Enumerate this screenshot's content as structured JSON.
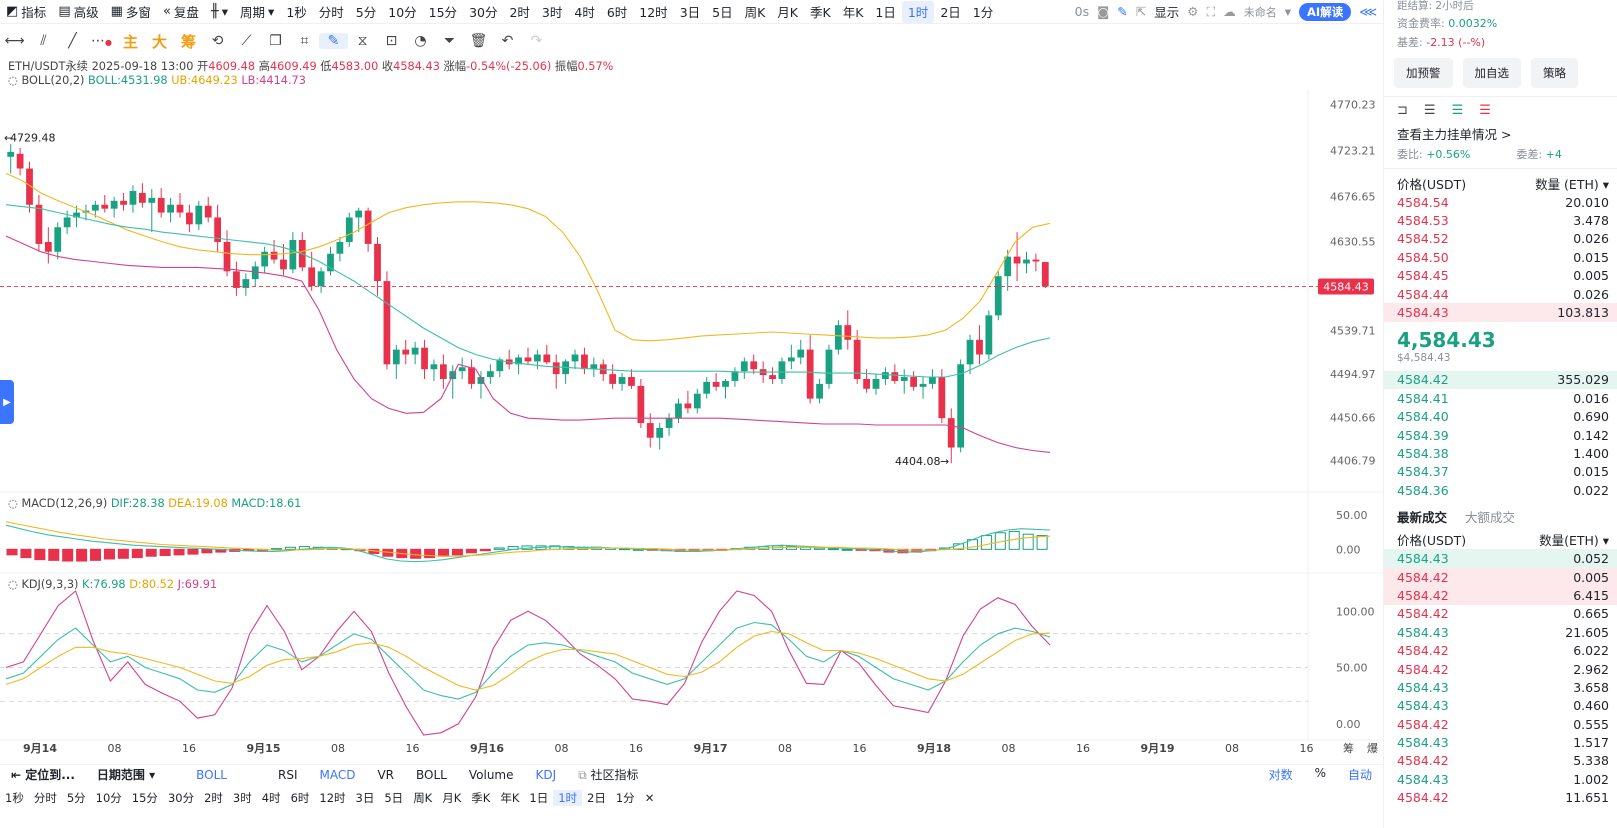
{
  "toolbar": {
    "items": [
      "指标",
      "高级",
      "多窗",
      "复盘",
      "",
      "周期",
      "1秒",
      "分时",
      "5分",
      "10分",
      "15分",
      "30分",
      "2时",
      "3时",
      "4时",
      "6时",
      "12时",
      "3日",
      "5日",
      "周K",
      "月K",
      "季K",
      "年K",
      "1日",
      "1时",
      "2日",
      "1分"
    ],
    "active": "1时",
    "right": {
      "seconds": "0s",
      "display": "显示",
      "unnamed": "未命名",
      "ai": "AI解读"
    }
  },
  "drawbar": {
    "levels": [
      "主",
      "大",
      "筹"
    ]
  },
  "legend": {
    "pair": "ETH/USDT永续",
    "time": "2025-09-18 13:00",
    "open_label": "开",
    "open": "4609.48",
    "high_label": "高",
    "high": "4609.49",
    "low_label": "低",
    "low": "4583.00",
    "close_label": "收",
    "close": "4584.43",
    "change_label": "涨幅",
    "change": "-0.54%(-25.06)",
    "amp_label": "振幅",
    "amp": "0.57%",
    "boll": "BOLL(20,2)",
    "boll_mid": "BOLL:4531.98",
    "boll_ub": "UB:4649.23",
    "boll_lb": "LB:4414.73",
    "macd": "MACD(12,26,9)",
    "dif": "DIF:28.38",
    "dea": "DEA:19.08",
    "macd_v": "MACD:18.61",
    "kdj": "KDJ(9,3,3)",
    "k": "K:76.98",
    "d": "D:80.52",
    "j": "J:69.91"
  },
  "chart_data": {
    "type": "candlestick",
    "price_axis": [
      "4770.23",
      "4723.21",
      "4676.65",
      "4630.55",
      "4584.43",
      "4539.71",
      "4494.97",
      "4450.66",
      "4406.79"
    ],
    "current_price": "4584.43",
    "max_label": "4729.48",
    "min_label": "4404.08",
    "macd_axis": [
      "50.00",
      "0.00"
    ],
    "kdj_axis": [
      "100.00",
      "50.00",
      "0.00"
    ],
    "time_axis": [
      "9月14",
      "08",
      "16",
      "9月15",
      "08",
      "16",
      "9月16",
      "08",
      "16",
      "9月17",
      "08",
      "16",
      "9月18",
      "08",
      "16",
      "9月19",
      "08",
      "16"
    ],
    "axis_corner": [
      "筹",
      "爆"
    ],
    "candles": [
      [
        4717,
        4730,
        4700,
        4722
      ],
      [
        4720,
        4726,
        4698,
        4705
      ],
      [
        4705,
        4712,
        4660,
        4668
      ],
      [
        4668,
        4678,
        4620,
        4628
      ],
      [
        4630,
        4645,
        4608,
        4620
      ],
      [
        4620,
        4650,
        4612,
        4645
      ],
      [
        4645,
        4662,
        4638,
        4655
      ],
      [
        4655,
        4667,
        4645,
        4660
      ],
      [
        4660,
        4668,
        4652,
        4662
      ],
      [
        4662,
        4672,
        4655,
        4668
      ],
      [
        4668,
        4678,
        4660,
        4664
      ],
      [
        4664,
        4676,
        4655,
        4672
      ],
      [
        4672,
        4680,
        4662,
        4668
      ],
      [
        4668,
        4688,
        4660,
        4682
      ],
      [
        4680,
        4690,
        4665,
        4670
      ],
      [
        4670,
        4684,
        4640,
        4675
      ],
      [
        4675,
        4685,
        4655,
        4660
      ],
      [
        4660,
        4675,
        4650,
        4668
      ],
      [
        4668,
        4680,
        4655,
        4660
      ],
      [
        4660,
        4668,
        4640,
        4648
      ],
      [
        4648,
        4672,
        4642,
        4667
      ],
      [
        4667,
        4676,
        4650,
        4655
      ],
      [
        4655,
        4668,
        4620,
        4630
      ],
      [
        4630,
        4642,
        4595,
        4600
      ],
      [
        4600,
        4610,
        4575,
        4583
      ],
      [
        4583,
        4598,
        4575,
        4592
      ],
      [
        4592,
        4610,
        4585,
        4605
      ],
      [
        4605,
        4625,
        4598,
        4620
      ],
      [
        4620,
        4632,
        4608,
        4612
      ],
      [
        4612,
        4628,
        4596,
        4602
      ],
      [
        4602,
        4640,
        4598,
        4632
      ],
      [
        4632,
        4640,
        4600,
        4604
      ],
      [
        4604,
        4620,
        4580,
        4585
      ],
      [
        4585,
        4604,
        4578,
        4600
      ],
      [
        4600,
        4625,
        4596,
        4618
      ],
      [
        4618,
        4635,
        4610,
        4630
      ],
      [
        4630,
        4660,
        4625,
        4655
      ],
      [
        4655,
        4665,
        4640,
        4662
      ],
      [
        4662,
        4665,
        4620,
        4628
      ],
      [
        4628,
        4635,
        4575,
        4590
      ],
      [
        4590,
        4600,
        4500,
        4505
      ],
      [
        4505,
        4525,
        4490,
        4520
      ],
      [
        4520,
        4530,
        4505,
        4515
      ],
      [
        4515,
        4528,
        4505,
        4522
      ],
      [
        4522,
        4530,
        4490,
        4500
      ],
      [
        4500,
        4510,
        4488,
        4505
      ],
      [
        4505,
        4515,
        4480,
        4490
      ],
      [
        4490,
        4504,
        4470,
        4498
      ],
      [
        4498,
        4512,
        4490,
        4502
      ],
      [
        4502,
        4510,
        4480,
        4485
      ],
      [
        4485,
        4498,
        4470,
        4492
      ],
      [
        4492,
        4505,
        4485,
        4498
      ],
      [
        4498,
        4512,
        4492,
        4510
      ],
      [
        4510,
        4520,
        4500,
        4505
      ],
      [
        4505,
        4515,
        4495,
        4512
      ],
      [
        4512,
        4522,
        4505,
        4508
      ],
      [
        4508,
        4520,
        4500,
        4515
      ],
      [
        4515,
        4525,
        4505,
        4507
      ],
      [
        4507,
        4515,
        4480,
        4495
      ],
      [
        4495,
        4510,
        4485,
        4508
      ],
      [
        4508,
        4520,
        4500,
        4515
      ],
      [
        4515,
        4522,
        4495,
        4500
      ],
      [
        4500,
        4512,
        4492,
        4505
      ],
      [
        4505,
        4510,
        4488,
        4495
      ],
      [
        4495,
        4505,
        4480,
        4485
      ],
      [
        4485,
        4496,
        4478,
        4492
      ],
      [
        4492,
        4500,
        4480,
        4483
      ],
      [
        4483,
        4490,
        4440,
        4445
      ],
      [
        4445,
        4455,
        4420,
        4430
      ],
      [
        4430,
        4445,
        4418,
        4440
      ],
      [
        4440,
        4455,
        4432,
        4450
      ],
      [
        4450,
        4470,
        4445,
        4465
      ],
      [
        4465,
        4478,
        4455,
        4460
      ],
      [
        4460,
        4480,
        4455,
        4475
      ],
      [
        4475,
        4492,
        4470,
        4487
      ],
      [
        4487,
        4496,
        4478,
        4482
      ],
      [
        4482,
        4490,
        4470,
        4488
      ],
      [
        4488,
        4502,
        4482,
        4498
      ],
      [
        4498,
        4512,
        4490,
        4508
      ],
      [
        4508,
        4515,
        4495,
        4500
      ],
      [
        4500,
        4508,
        4486,
        4494
      ],
      [
        4494,
        4502,
        4485,
        4490
      ],
      [
        4490,
        4512,
        4485,
        4508
      ],
      [
        4508,
        4525,
        4500,
        4512
      ],
      [
        4512,
        4530,
        4505,
        4520
      ],
      [
        4520,
        4535,
        4465,
        4470
      ],
      [
        4470,
        4490,
        4465,
        4485
      ],
      [
        4485,
        4525,
        4480,
        4520
      ],
      [
        4520,
        4550,
        4515,
        4545
      ],
      [
        4545,
        4560,
        4520,
        4530
      ],
      [
        4530,
        4540,
        4485,
        4490
      ],
      [
        4490,
        4500,
        4476,
        4480
      ],
      [
        4480,
        4495,
        4474,
        4490
      ],
      [
        4490,
        4502,
        4484,
        4497
      ],
      [
        4497,
        4505,
        4485,
        4488
      ],
      [
        4488,
        4500,
        4475,
        4492
      ],
      [
        4492,
        4498,
        4478,
        4482
      ],
      [
        4482,
        4492,
        4470,
        4485
      ],
      [
        4485,
        4500,
        4480,
        4492
      ],
      [
        4492,
        4500,
        4445,
        4450
      ],
      [
        4450,
        4460,
        4404,
        4420
      ],
      [
        4420,
        4510,
        4415,
        4505
      ],
      [
        4505,
        4535,
        4495,
        4530
      ],
      [
        4530,
        4545,
        4505,
        4515
      ],
      [
        4515,
        4560,
        4510,
        4555
      ],
      [
        4555,
        4600,
        4550,
        4595
      ],
      [
        4595,
        4622,
        4580,
        4615
      ],
      [
        4615,
        4640,
        4590,
        4608
      ],
      [
        4608,
        4620,
        4598,
        4612
      ],
      [
        4612,
        4618,
        4600,
        4610
      ],
      [
        4609.48,
        4609.49,
        4583.0,
        4584.43
      ]
    ],
    "boll_ub_values": [
      4700,
      4692,
      4680,
      4672,
      4665,
      4658,
      4650,
      4642,
      4636,
      4630,
      4625,
      4622,
      4620,
      4618,
      4617,
      4617,
      4618,
      4620,
      4625,
      4632,
      4640,
      4650,
      4660,
      4665,
      4668,
      4670,
      4671,
      4671,
      4670,
      4668,
      4664,
      4656,
      4640,
      4615,
      4580,
      4540,
      4530,
      4529,
      4530,
      4532,
      4534,
      4535,
      4536,
      4537,
      4538,
      4537,
      4536,
      4535,
      4534,
      4533,
      4532,
      4532,
      4533,
      4535,
      4540,
      4552,
      4570,
      4600,
      4630,
      4645,
      4649
    ],
    "boll_mid_values": [
      4668,
      4666,
      4664,
      4660,
      4656,
      4652,
      4648,
      4645,
      4643,
      4640,
      4638,
      4636,
      4634,
      4632,
      4630,
      4628,
      4624,
      4618,
      4610,
      4600,
      4590,
      4578,
      4566,
      4554,
      4542,
      4532,
      4522,
      4515,
      4510,
      4507,
      4505,
      4503,
      4502,
      4501,
      4500,
      4499,
      4498,
      4498,
      4498,
      4498,
      4498,
      4498,
      4497,
      4497,
      4497,
      4497,
      4497,
      4496,
      4496,
      4496,
      4495,
      4494,
      4493,
      4492,
      4492,
      4496,
      4504,
      4514,
      4522,
      4528,
      4532
    ],
    "boll_lb_values": [
      4636,
      4628,
      4620,
      4615,
      4612,
      4610,
      4608,
      4606,
      4605,
      4604,
      4604,
      4604,
      4603,
      4602,
      4600,
      4598,
      4595,
      4590,
      4560,
      4520,
      4490,
      4470,
      4460,
      4455,
      4456,
      4470,
      4505,
      4500,
      4470,
      4455,
      4450,
      4449,
      4448,
      4448,
      4449,
      4450,
      4450,
      4450,
      4450,
      4450,
      4450,
      4450,
      4449,
      4448,
      4447,
      4446,
      4445,
      4444,
      4444,
      4444,
      4443,
      4443,
      4443,
      4443,
      4443,
      4440,
      4432,
      4425,
      4420,
      4417,
      4415
    ],
    "macd_hist": [
      -8,
      -12,
      -15,
      -16,
      -17,
      -17,
      -16,
      -14,
      -13,
      -12,
      -10,
      -9,
      -8,
      -7,
      -5,
      -4,
      -3,
      -2,
      -1,
      1,
      3,
      4,
      3,
      2,
      1,
      -2,
      -6,
      -10,
      -12,
      -13,
      -12,
      -10,
      -8,
      -5,
      -2,
      2,
      4,
      5,
      5,
      5,
      4,
      3,
      3,
      2,
      1,
      0,
      -1,
      -2,
      -3,
      -3,
      -2,
      -1,
      1,
      3,
      4,
      5,
      4,
      3,
      2,
      1,
      0,
      -1,
      -2,
      -4,
      -5,
      -4,
      -2,
      2,
      8,
      14,
      20,
      24,
      26,
      22,
      20
    ],
    "macd_dif": [
      35,
      30,
      25,
      21,
      18,
      15,
      12,
      10,
      8,
      6,
      5,
      4,
      3,
      2,
      1,
      0,
      -1,
      -2,
      -3,
      -3,
      -2,
      0,
      2,
      3,
      2,
      -2,
      -8,
      -14,
      -17,
      -18,
      -17,
      -15,
      -12,
      -9,
      -6,
      -3,
      0,
      2,
      3,
      4,
      3,
      3,
      3,
      2,
      1,
      0,
      -1,
      -2,
      -3,
      -3,
      -2,
      -1,
      1,
      3,
      5,
      6,
      5,
      4,
      3,
      2,
      1,
      0,
      -1,
      -3,
      -4,
      -3,
      -1,
      3,
      10,
      18,
      24,
      28,
      30,
      29,
      28
    ],
    "macd_dea": [
      40,
      36,
      32,
      28,
      24,
      21,
      18,
      15,
      13,
      11,
      9,
      7,
      6,
      5,
      4,
      3,
      2,
      1,
      0,
      -1,
      -1,
      -1,
      0,
      1,
      1,
      0,
      -2,
      -4,
      -6,
      -8,
      -9,
      -10,
      -10,
      -9,
      -8,
      -6,
      -4,
      -3,
      -1,
      0,
      1,
      1,
      2,
      2,
      2,
      1,
      1,
      0,
      -1,
      -1,
      -1,
      -1,
      0,
      1,
      2,
      3,
      3,
      3,
      3,
      3,
      2,
      2,
      1,
      0,
      -1,
      -1,
      -1,
      0,
      2,
      5,
      9,
      13,
      16,
      18,
      19
    ],
    "kdj_k": [
      40,
      45,
      60,
      75,
      85,
      70,
      55,
      60,
      50,
      45,
      40,
      30,
      28,
      35,
      55,
      70,
      65,
      55,
      60,
      70,
      80,
      75,
      60,
      45,
      30,
      25,
      22,
      28,
      45,
      60,
      70,
      72,
      70,
      65,
      60,
      55,
      45,
      40,
      35,
      40,
      55,
      70,
      85,
      90,
      88,
      75,
      60,
      55,
      65,
      60,
      50,
      40,
      35,
      30,
      38,
      55,
      70,
      80,
      85,
      82,
      77
    ],
    "kdj_d": [
      35,
      40,
      50,
      60,
      68,
      68,
      64,
      62,
      58,
      54,
      50,
      44,
      38,
      36,
      42,
      52,
      57,
      58,
      60,
      64,
      70,
      72,
      68,
      60,
      50,
      42,
      34,
      30,
      34,
      44,
      55,
      62,
      66,
      66,
      64,
      62,
      56,
      50,
      44,
      42,
      46,
      55,
      68,
      78,
      82,
      80,
      72,
      65,
      65,
      63,
      58,
      52,
      46,
      40,
      38,
      44,
      54,
      64,
      74,
      80,
      80.5
    ],
    "kdj_j": [
      50,
      55,
      80,
      105,
      118,
      74,
      38,
      55,
      35,
      27,
      20,
      5,
      8,
      32,
      80,
      105,
      82,
      48,
      60,
      82,
      100,
      82,
      45,
      15,
      -10,
      -8,
      0,
      24,
      67,
      92,
      100,
      92,
      78,
      62,
      52,
      40,
      22,
      20,
      17,
      36,
      73,
      100,
      118,
      114,
      100,
      65,
      36,
      35,
      65,
      54,
      34,
      16,
      13,
      10,
      38,
      78,
      102,
      112,
      106,
      86,
      70
    ]
  },
  "bottom": {
    "locate": "定位到...",
    "date_range": "日期范围",
    "indicators": [
      "BOLL",
      "RSI",
      "MACD",
      "VR",
      "BOLL",
      "Volume",
      "KDJ"
    ],
    "community": "社区指标",
    "right": [
      "对数",
      "%",
      "自动"
    ],
    "periods": [
      "1秒",
      "分时",
      "5分",
      "10分",
      "15分",
      "30分",
      "2时",
      "3时",
      "4时",
      "6时",
      "12时",
      "3日",
      "5日",
      "周K",
      "月K",
      "季K",
      "年K",
      "1日",
      "1时",
      "2日",
      "1分",
      "✕"
    ],
    "active": "1时"
  },
  "panel": {
    "settle_label": "距结算:",
    "settle": "2小时后",
    "funding_label": "资金费率:",
    "funding": "0.0032%",
    "basis_label": "基差:",
    "basis": "-2.13 (--%)",
    "buttons": [
      "加预警",
      "加自选",
      "策略"
    ],
    "depth_link": "查看主力挂单情况 >",
    "ratio_label": "委比:",
    "ratio": "+0.56%",
    "diff_label": "委差:",
    "diff": "+4",
    "ob_price_head": "价格(USDT)",
    "ob_qty_head": "数量 (ETH)",
    "asks": [
      [
        "4584.54",
        "20.010"
      ],
      [
        "4584.53",
        "3.478"
      ],
      [
        "4584.52",
        "0.026"
      ],
      [
        "4584.50",
        "0.015"
      ],
      [
        "4584.45",
        "0.005"
      ],
      [
        "4584.44",
        "0.026"
      ],
      [
        "4584.43",
        "103.813"
      ]
    ],
    "last_price": "4,584.43",
    "last_price_sub": "$4,584.43",
    "bids": [
      [
        "4584.42",
        "355.029"
      ],
      [
        "4584.41",
        "0.016"
      ],
      [
        "4584.40",
        "0.690"
      ],
      [
        "4584.39",
        "0.142"
      ],
      [
        "4584.38",
        "1.400"
      ],
      [
        "4584.37",
        "0.015"
      ],
      [
        "4584.36",
        "0.022"
      ]
    ],
    "trade_tabs": [
      "最新成交",
      "大额成交"
    ],
    "trade_price_head": "价格(USDT)",
    "trade_qty_head": "数量(ETH)",
    "trades": [
      [
        "4584.43",
        "0.052",
        "g"
      ],
      [
        "4584.42",
        "0.005",
        "r"
      ],
      [
        "4584.42",
        "6.415",
        "r"
      ],
      [
        "4584.42",
        "0.665",
        "r"
      ],
      [
        "4584.43",
        "21.605",
        "g"
      ],
      [
        "4584.42",
        "6.022",
        "r"
      ],
      [
        "4584.42",
        "2.962",
        "r"
      ],
      [
        "4584.43",
        "3.658",
        "g"
      ],
      [
        "4584.43",
        "0.460",
        "g"
      ],
      [
        "4584.42",
        "0.555",
        "r"
      ],
      [
        "4584.43",
        "1.517",
        "g"
      ],
      [
        "4584.42",
        "5.338",
        "r"
      ],
      [
        "4584.43",
        "1.002",
        "g"
      ],
      [
        "4584.42",
        "11.651",
        "r"
      ]
    ]
  },
  "colors": {
    "up": "#1aa182",
    "down": "#e8324b",
    "ub": "#f2b821",
    "mid": "#3dbfa8",
    "lb": "#d3418c",
    "accent": "#3a74ff"
  }
}
